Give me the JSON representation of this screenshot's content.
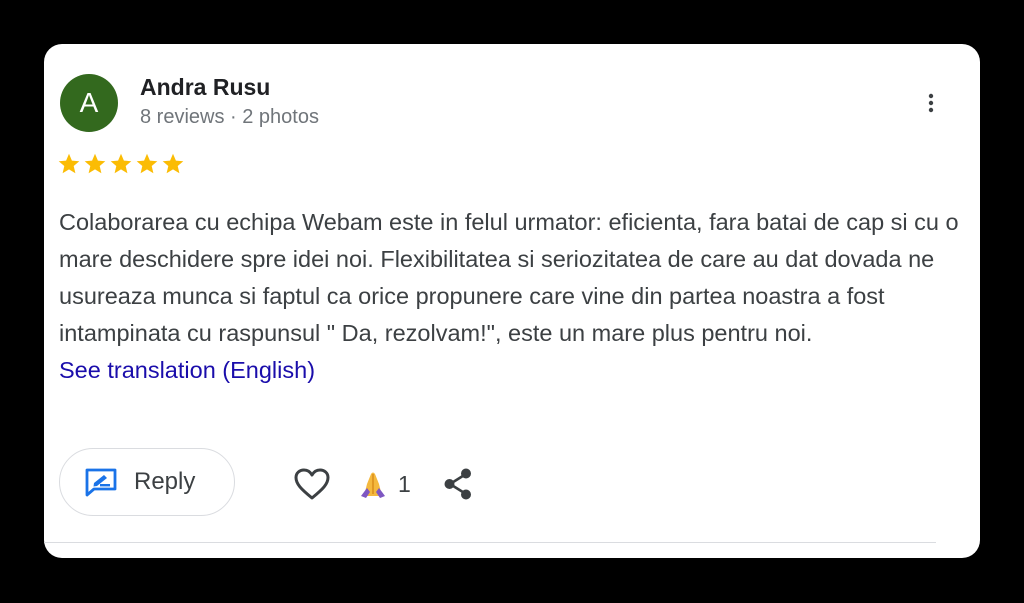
{
  "reviewer": {
    "avatar_letter": "A",
    "name": "Andra Rusu",
    "meta": "8 reviews · 2 photos"
  },
  "rating": {
    "stars": 5,
    "max": 5,
    "star_color": "#fbbc04"
  },
  "review": {
    "text": "Colaborarea cu echipa Webam este in felul urmator: eficienta, fara batai de cap si cu o mare deschidere spre idei noi. Flexibilitatea si seriozitatea de care au dat dovada ne usureaza munca si faptul ca orice propunere care vine din partea noastra a fost intampinata cu raspunsul \" Da, rezolvam!\", este un mare plus pentru noi.",
    "translate_link": "See translation (English)"
  },
  "actions": {
    "reply_label": "Reply",
    "reaction_emoji": "🙏",
    "reaction_count": "1"
  },
  "icons": {
    "more": "more-vert-icon",
    "reply": "reply-icon",
    "like": "heart-outline-icon",
    "share": "share-icon"
  },
  "colors": {
    "avatar_bg": "#33691e",
    "link": "#1a0dab",
    "reply_icon": "#1a73e8"
  }
}
